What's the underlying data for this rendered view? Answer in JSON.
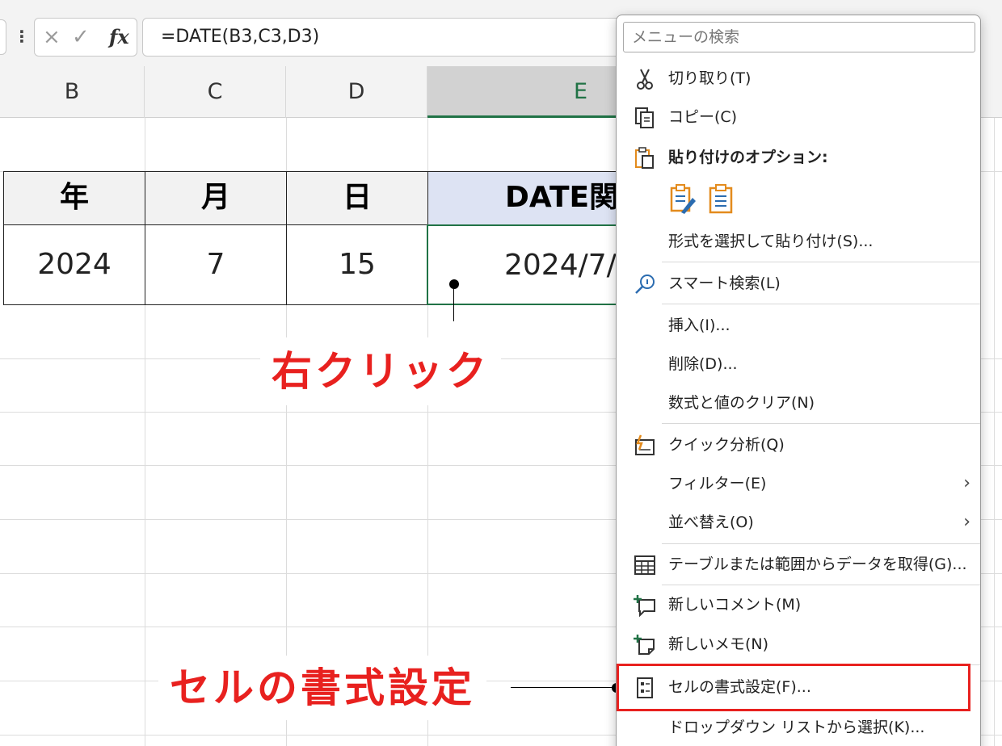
{
  "formula_bar": {
    "menu_dots": "⋮",
    "cancel_glyph": "×",
    "confirm_glyph": "✓",
    "fx_label": "fx",
    "formula": "=DATE(B3,C3,D3)"
  },
  "columns": [
    "B",
    "C",
    "D",
    "E"
  ],
  "table": {
    "headers": [
      "年",
      "月",
      "日",
      "DATE関"
    ],
    "values": [
      "2024",
      "7",
      "15",
      "2024/7/"
    ]
  },
  "annotations": {
    "right_click": "右クリック",
    "format_cells": "セルの書式設定"
  },
  "colors": {
    "accent_green": "#217346",
    "annotation_red": "#e8211f",
    "icon_blue": "#2b6cb0",
    "icon_orange": "#e38b1d"
  },
  "context_menu": {
    "search_placeholder": "メニューの検索",
    "items": {
      "cut": {
        "label": "切り取り(T)",
        "icon": "scissors-icon"
      },
      "copy": {
        "label": "コピー(C)",
        "icon": "copy-icon"
      },
      "paste_options": {
        "label": "貼り付けのオプション:",
        "icon": "clipboard-icon"
      },
      "paste_special": {
        "label": "形式を選択して貼り付け(S)..."
      },
      "smart_lookup": {
        "label": "スマート検索(L)",
        "icon": "smart-lookup-icon"
      },
      "insert": {
        "label": "挿入(I)..."
      },
      "delete": {
        "label": "削除(D)..."
      },
      "clear_contents": {
        "label": "数式と値のクリア(N)"
      },
      "quick_analysis": {
        "label": "クイック分析(Q)",
        "icon": "quick-analysis-icon"
      },
      "filter": {
        "label": "フィルター(E)",
        "chevron": "›"
      },
      "sort": {
        "label": "並べ替え(O)",
        "chevron": "›"
      },
      "get_data": {
        "label": "テーブルまたは範囲からデータを取得(G)...",
        "icon": "table-icon"
      },
      "new_comment": {
        "label": "新しいコメント(M)",
        "icon": "new-comment-icon"
      },
      "new_note": {
        "label": "新しいメモ(N)",
        "icon": "new-note-icon"
      },
      "format_cells": {
        "label": "セルの書式設定(F)...",
        "icon": "format-cells-icon"
      },
      "dropdown_list": {
        "label": "ドロップダウン リストから選択(K)..."
      }
    }
  }
}
